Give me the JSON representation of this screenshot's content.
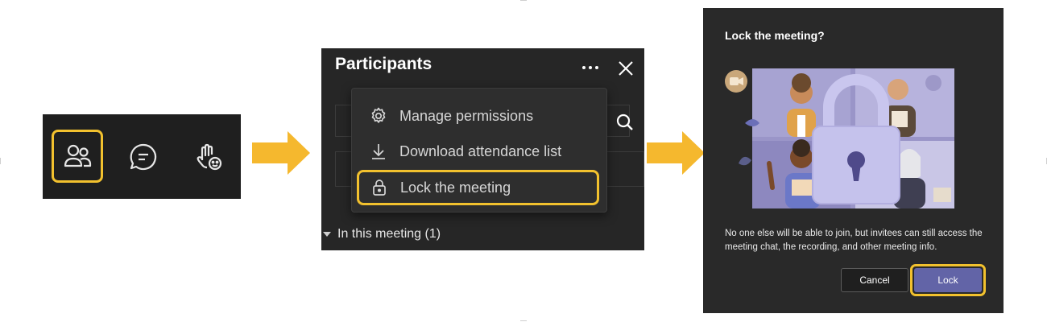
{
  "colors": {
    "highlight": "#f2c12e",
    "arrow": "#f5b82e",
    "lock_button": "#6264a7"
  },
  "toolbar": {
    "buttons": [
      {
        "icon": "people-icon",
        "highlighted": true
      },
      {
        "icon": "chat-icon",
        "highlighted": false
      },
      {
        "icon": "raise-hand-react-icon",
        "highlighted": false
      }
    ]
  },
  "participants": {
    "title": "Participants",
    "more_icon": "more-options-icon",
    "close_icon": "close-icon",
    "search_icon": "search-icon",
    "section_label": "In this meeting (1)",
    "menu": [
      {
        "icon": "gear-icon",
        "label": "Manage permissions",
        "highlighted": false
      },
      {
        "icon": "download-icon",
        "label": "Download attendance list",
        "highlighted": false
      },
      {
        "icon": "lock-icon",
        "label": "Lock the meeting",
        "highlighted": true
      }
    ]
  },
  "dialog": {
    "title": "Lock the meeting?",
    "text": "No one else will be able to join, but invitees can still access the meeting chat, the recording, and other meeting info.",
    "cancel_label": "Cancel",
    "lock_label": "Lock"
  }
}
